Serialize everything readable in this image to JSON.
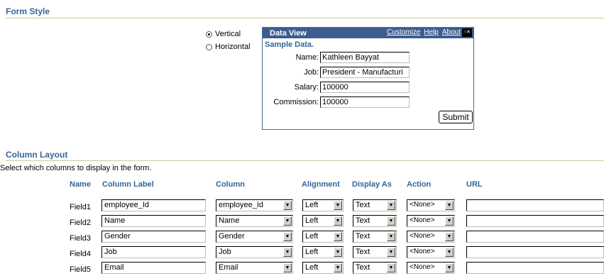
{
  "form_style": {
    "title": "Form Style",
    "options": [
      {
        "label": "Vertical",
        "checked": true
      },
      {
        "label": "Horizontal",
        "checked": false
      }
    ]
  },
  "data_view": {
    "title": "Data View",
    "links": [
      "Customize",
      "Help",
      "About"
    ],
    "sample_title": "Sample Data.",
    "fields": [
      {
        "label": "Name:",
        "value": "Kathleen Bayyat"
      },
      {
        "label": "Job:",
        "value": "President - Manufacturi"
      },
      {
        "label": "Salary:",
        "value": "100000"
      },
      {
        "label": "Commission:",
        "value": "100000"
      }
    ],
    "submit_label": "Submit"
  },
  "column_layout": {
    "title": "Column Layout",
    "description": "Select which columns to display in the form.",
    "headers": {
      "name": "Name",
      "column_label": "Column Label",
      "column": "Column",
      "alignment": "Alignment",
      "display_as": "Display As",
      "action": "Action",
      "url": "URL"
    },
    "rows": [
      {
        "name": "Field1",
        "label": "employee_Id",
        "column": "employee_Id",
        "alignment": "Left",
        "display": "Text",
        "action": "<None>",
        "url": ""
      },
      {
        "name": "Field2",
        "label": "Name",
        "column": "Name",
        "alignment": "Left",
        "display": "Text",
        "action": "<None>",
        "url": ""
      },
      {
        "name": "Field3",
        "label": "Gender",
        "column": "Gender",
        "alignment": "Left",
        "display": "Text",
        "action": "<None>",
        "url": ""
      },
      {
        "name": "Field4",
        "label": "Job",
        "column": "Job",
        "alignment": "Left",
        "display": "Text",
        "action": "<None>",
        "url": ""
      },
      {
        "name": "Field5",
        "label": "Email",
        "column": "Email",
        "alignment": "Left",
        "display": "Text",
        "action": "<None>",
        "url": ""
      }
    ]
  }
}
